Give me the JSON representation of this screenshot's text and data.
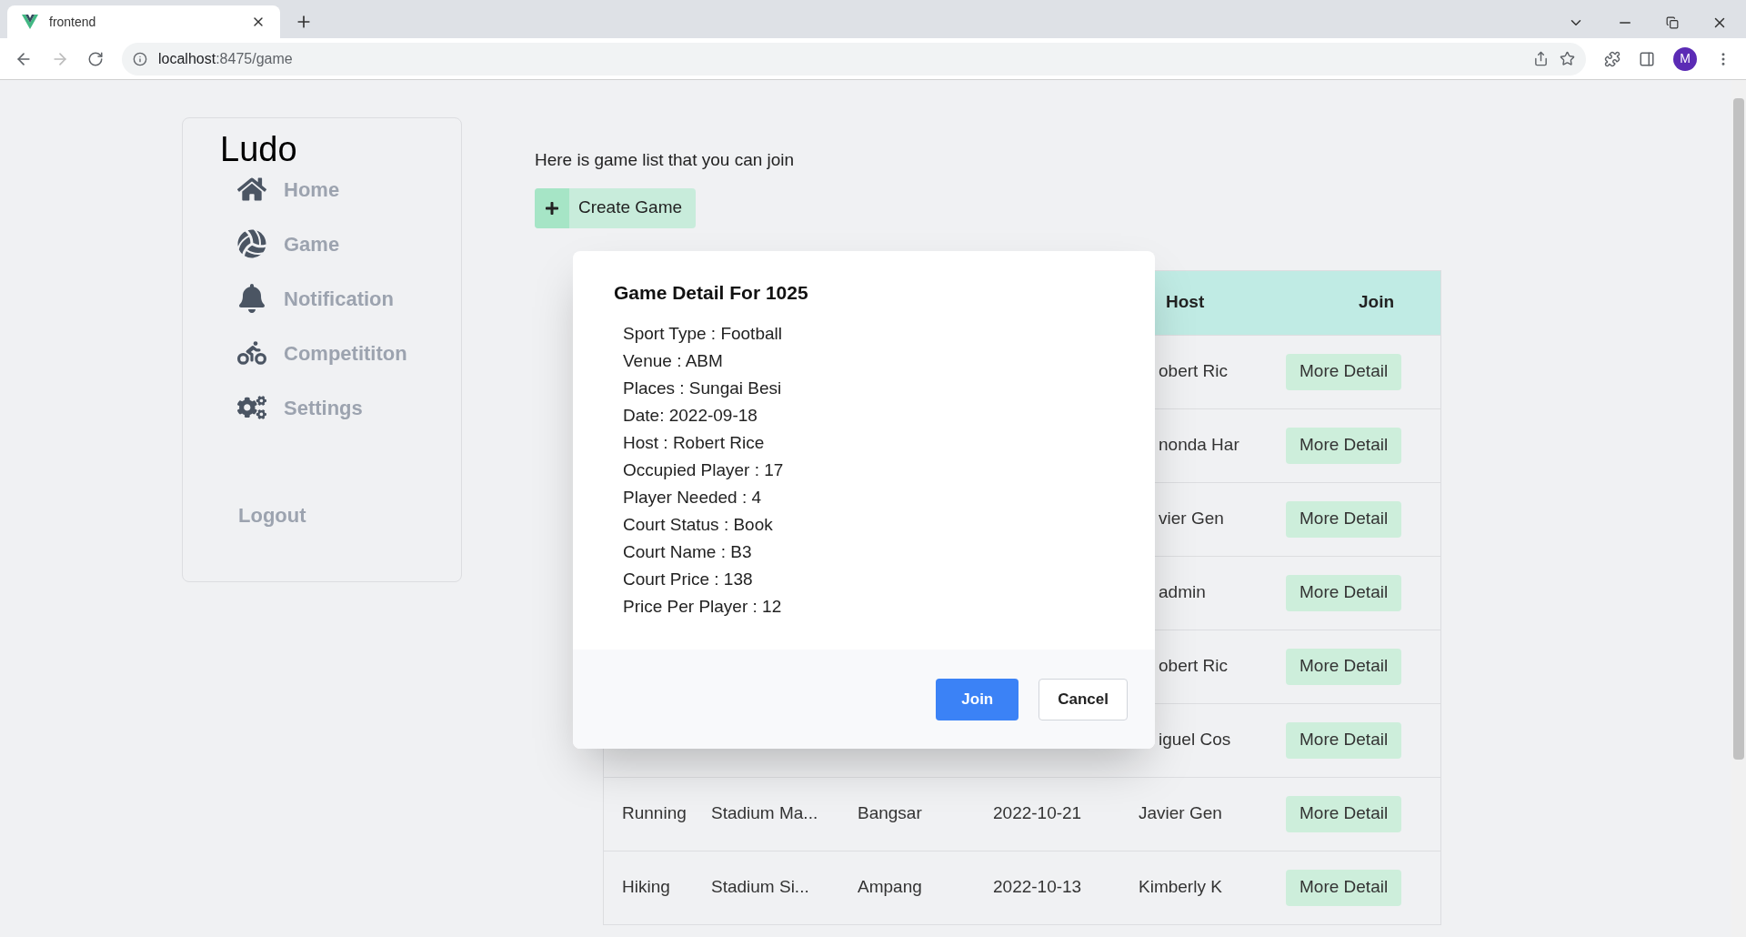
{
  "browser": {
    "tab_title": "frontend",
    "url_host": "localhost",
    "url_rest": ":8475/game",
    "profile_initial": "M"
  },
  "sidebar": {
    "logo": "Ludo",
    "items": [
      {
        "label": "Home"
      },
      {
        "label": "Game"
      },
      {
        "label": "Notification"
      },
      {
        "label": "Competititon"
      },
      {
        "label": "Settings"
      }
    ],
    "logout": "Logout"
  },
  "main": {
    "intro": "Here is game list that you can join",
    "create_button": "Create Game"
  },
  "table": {
    "columns": [
      "Host",
      "Join"
    ],
    "rows": [
      {
        "host": "obert Ric",
        "join": "More Detail"
      },
      {
        "host": "nonda Har",
        "join": "More Detail"
      },
      {
        "host": "vier Gen",
        "join": "More Detail"
      },
      {
        "host": "admin",
        "join": "More Detail"
      },
      {
        "host": "obert Ric",
        "join": "More Detail"
      },
      {
        "host": "iguel Cos",
        "join": "More Detail"
      },
      {
        "sport": "Running",
        "venue": "Stadium Ma...",
        "place": "Bangsar",
        "date": "2022-10-21",
        "host": "Javier Gen",
        "join": "More Detail"
      },
      {
        "sport": "Hiking",
        "venue": "Stadium Si...",
        "place": "Ampang",
        "date": "2022-10-13",
        "host": "Kimberly K",
        "join": "More Detail"
      }
    ]
  },
  "modal": {
    "title": "Game Detail For 1025",
    "lines": [
      "Sport Type : Football",
      "Venue : ABM",
      "Places : Sungai Besi",
      "Date: 2022-09-18",
      "Host : Robert Rice",
      "Occupied Player : 17",
      "Player Needed : 4",
      "Court Status : Book",
      "Court Name : B3",
      "Court Price : 138",
      "Price Per Player : 12"
    ],
    "buttons": [
      {
        "label": "Join",
        "kind": "primary"
      },
      {
        "label": "Cancel",
        "kind": "secondary"
      }
    ]
  }
}
